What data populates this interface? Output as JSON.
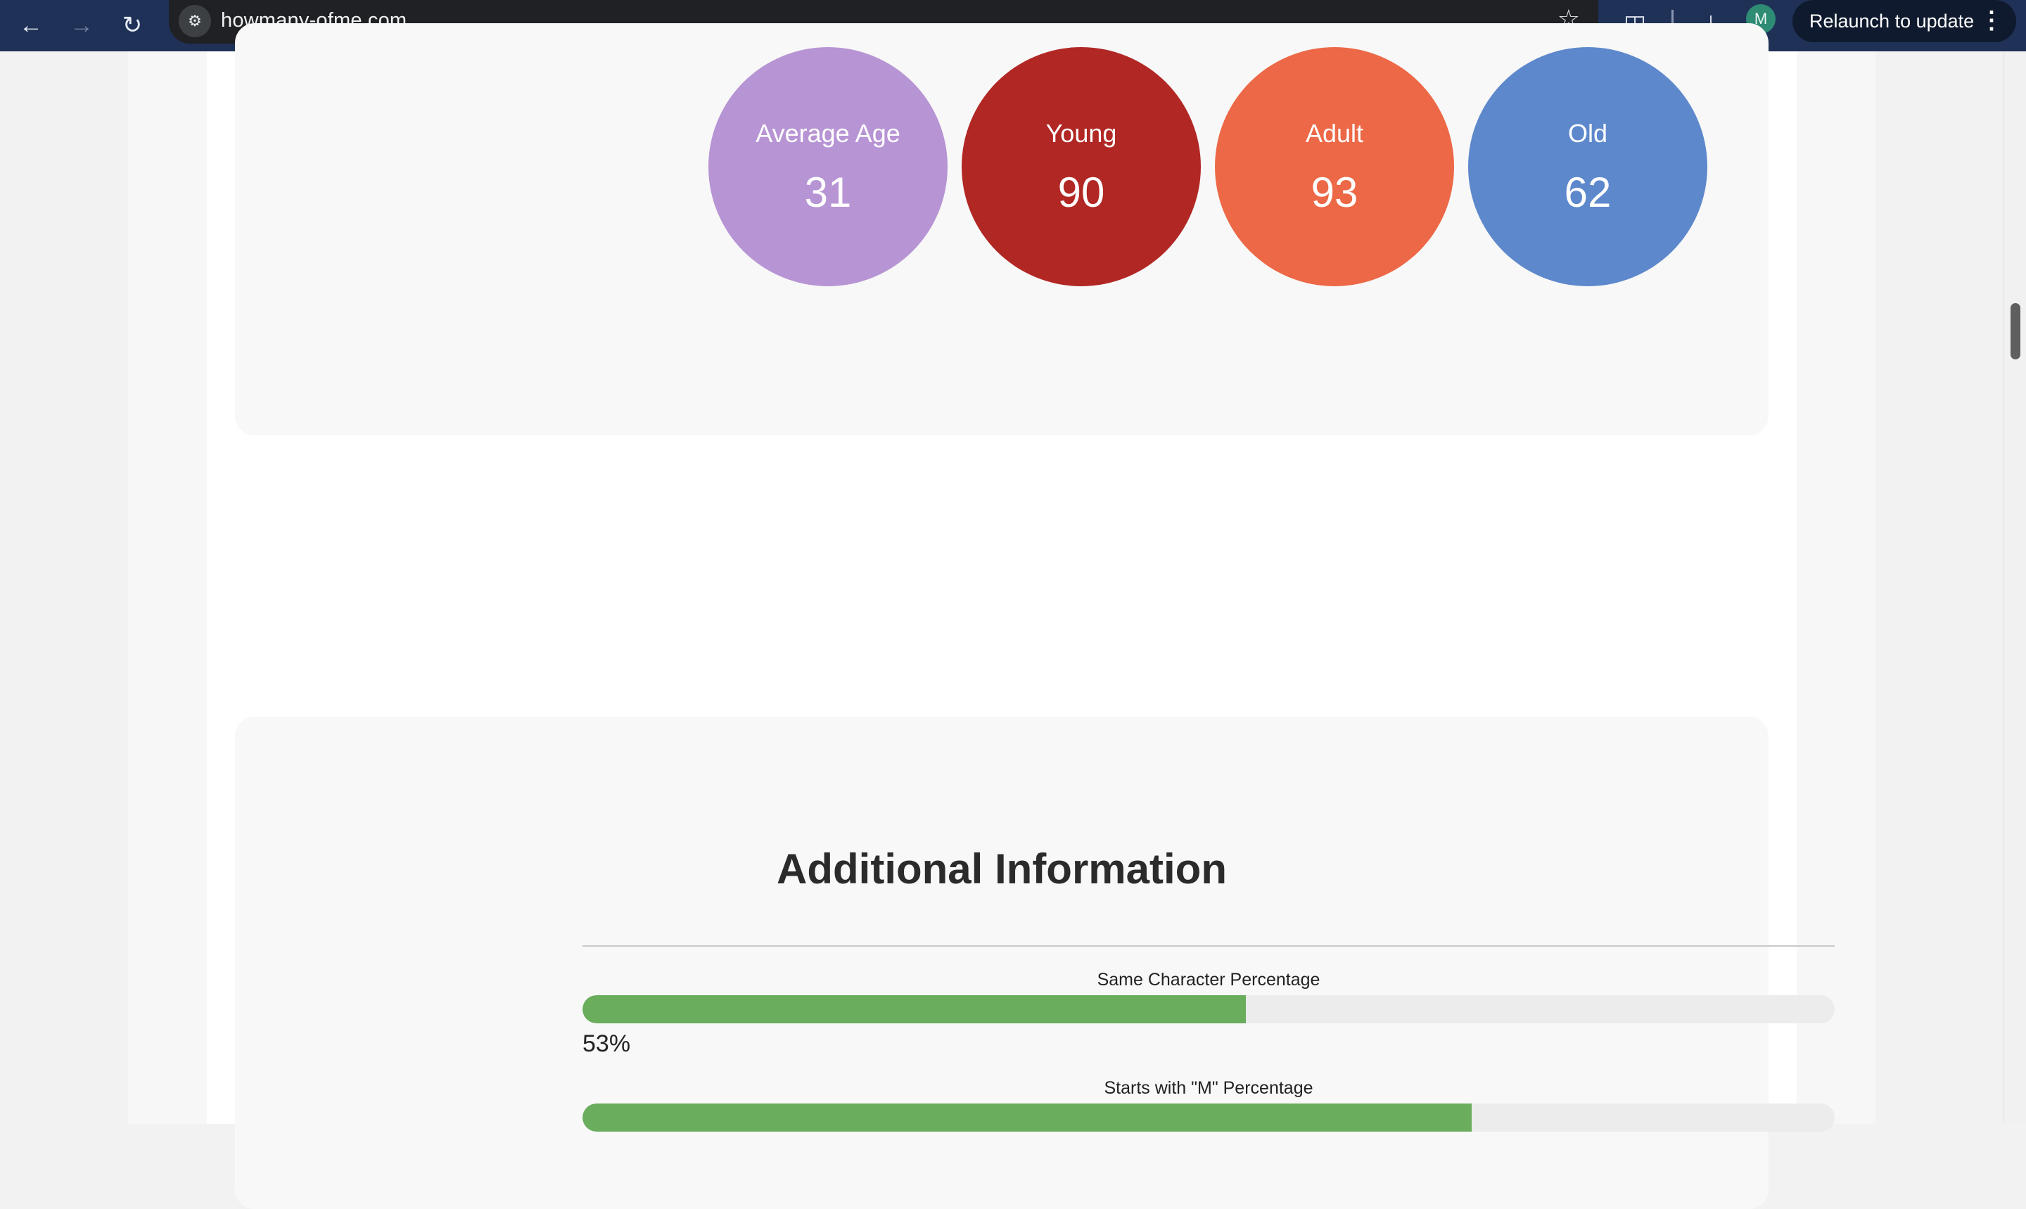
{
  "browser": {
    "url": "howmany-ofme.com",
    "relaunch_label": "Relaunch to update",
    "profile_initial": "M"
  },
  "age_stats": [
    {
      "label": "Average Age",
      "value": "31",
      "color": "#b794d4"
    },
    {
      "label": "Young",
      "value": "90",
      "color": "#b12724"
    },
    {
      "label": "Adult",
      "value": "93",
      "color": "#ec6846"
    },
    {
      "label": "Old",
      "value": "62",
      "color": "#5d88cc"
    }
  ],
  "additional_info": {
    "title": "Additional Information",
    "stats": [
      {
        "label": "Same Character Percentage",
        "percent": 53,
        "value_text": "53%"
      },
      {
        "label": "Starts with \"M\" Percentage",
        "percent": 71
      }
    ]
  },
  "colors": {
    "bar_fill": "#6aad5d",
    "bar_track": "#ececec"
  }
}
